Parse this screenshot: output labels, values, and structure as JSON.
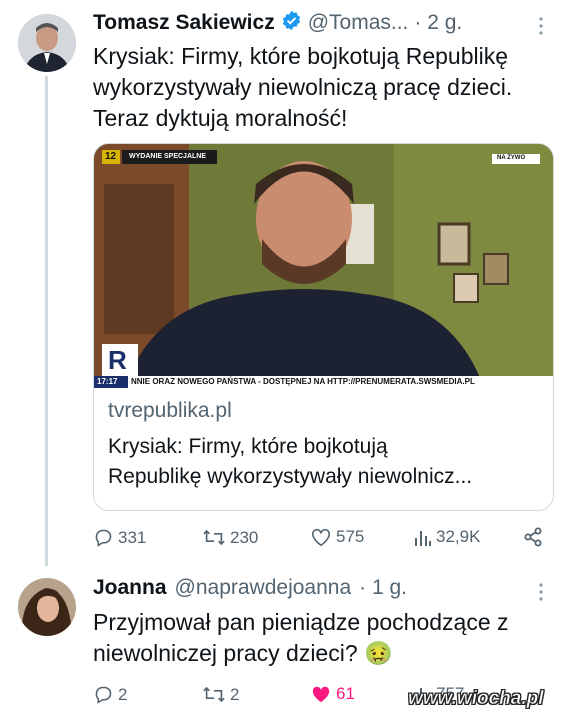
{
  "tweet": {
    "author_name": "Tomasz Sakiewicz",
    "handle": "@Tomas...",
    "time": "· 2 g.",
    "text_lines": [
      "Krysiak: Firmy, które bojkotują Republikę",
      "wykorzystywały niewolniczą pracę dzieci.",
      "Teraz dyktują moralność!"
    ],
    "card": {
      "channel_number": "12",
      "badge": "WYDANIE SPECJALNE",
      "live_tag": "NA ŻYWO",
      "ticker_time": "17:17",
      "ticker": "NNIE ORAZ NOWEGO PAŃSTWA - DOSTĘPNEJ NA HTTP://PRENUMERATA.SWSMEDIA.PL",
      "logo": "R",
      "domain": "tvrepublika.pl",
      "title_lines": [
        "Krysiak: Firmy, które bojkotują",
        "Republikę wykorzystywały niewolnicz..."
      ]
    },
    "actions": {
      "replies": "331",
      "reposts": "230",
      "likes": "575",
      "views": "32,9K"
    }
  },
  "reply": {
    "author_name": "Joanna",
    "handle": "@naprawdejoanna",
    "time": "· 1 g.",
    "text_lines": [
      "Przyjmował pan pieniądze pochodzące z",
      "niewolniczej pracy dzieci?"
    ],
    "emoji": "🤢",
    "actions": {
      "replies": "2",
      "reposts": "2",
      "likes": "61",
      "views": "757"
    }
  },
  "watermark": "www.wiocha.pl",
  "colors": {
    "verified": "#1d9bf0",
    "liked": "#f91880",
    "muted": "#536471"
  },
  "icons": [
    "verified-badge-icon",
    "more-icon",
    "reply-icon",
    "repost-icon",
    "like-icon",
    "views-icon",
    "share-icon"
  ]
}
